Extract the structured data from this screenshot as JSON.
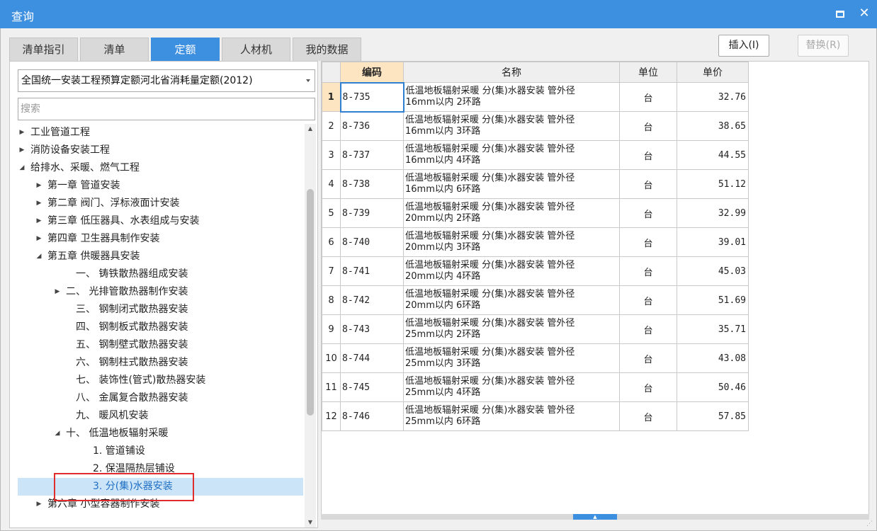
{
  "window": {
    "title": "查询"
  },
  "tabs": [
    {
      "label": "清单指引"
    },
    {
      "label": "清单"
    },
    {
      "label": "定额"
    },
    {
      "label": "人材机"
    },
    {
      "label": "我的数据"
    }
  ],
  "buttons": {
    "insert": "插入(I)",
    "replace": "替换(R)"
  },
  "left": {
    "dropdown_value": "全国统一安装工程预算定额河北省消耗量定额(2012)",
    "search_placeholder": "搜索"
  },
  "tree": [
    {
      "label": "工业管道工程",
      "arrow": "right"
    },
    {
      "label": "消防设备安装工程",
      "arrow": "right"
    },
    {
      "label": "给排水、采暖、燃气工程",
      "arrow": "down"
    },
    {
      "label": "第一章 管道安装",
      "arrow": "right"
    },
    {
      "label": "第二章 阀门、浮标液面计安装",
      "arrow": "right"
    },
    {
      "label": "第三章 低压器具、水表组成与安装",
      "arrow": "right"
    },
    {
      "label": "第四章 卫生器具制作安装",
      "arrow": "right"
    },
    {
      "label": "第五章 供暖器具安装",
      "arrow": "down"
    },
    {
      "label": "一、 铸铁散热器组成安装",
      "arrow": "none"
    },
    {
      "label": "二、 光排管散热器制作安装",
      "arrow": "right"
    },
    {
      "label": "三、 钢制闭式散热器安装",
      "arrow": "none"
    },
    {
      "label": "四、 钢制板式散热器安装",
      "arrow": "none"
    },
    {
      "label": "五、 钢制壁式散热器安装",
      "arrow": "none"
    },
    {
      "label": "六、 钢制柱式散热器安装",
      "arrow": "none"
    },
    {
      "label": "七、 装饰性(管式)散热器安装",
      "arrow": "none"
    },
    {
      "label": "八、 金属复合散热器安装",
      "arrow": "none"
    },
    {
      "label": "九、 暖风机安装",
      "arrow": "none"
    },
    {
      "label": "十、 低温地板辐射采暖",
      "arrow": "down"
    },
    {
      "label": "1. 管道铺设",
      "arrow": "none"
    },
    {
      "label": "2. 保温隔热层铺设",
      "arrow": "none"
    },
    {
      "label": "3. 分(集)水器安装",
      "arrow": "none",
      "selected": true
    },
    {
      "label": "第六章 小型容器制作安装",
      "arrow": "right"
    }
  ],
  "grid": {
    "headers": {
      "code": "编码",
      "name": "名称",
      "unit": "单位",
      "price": "单价"
    },
    "rows": [
      {
        "num": "1",
        "code": "8-735",
        "name_line1": "低温地板辐射采暖 分(集)水器安装 管外径",
        "name_line2": "16mm以内 2环路",
        "unit": "台",
        "price": "32.76"
      },
      {
        "num": "2",
        "code": "8-736",
        "name_line1": "低温地板辐射采暖 分(集)水器安装 管外径",
        "name_line2": "16mm以内 3环路",
        "unit": "台",
        "price": "38.65"
      },
      {
        "num": "3",
        "code": "8-737",
        "name_line1": "低温地板辐射采暖 分(集)水器安装 管外径",
        "name_line2": "16mm以内 4环路",
        "unit": "台",
        "price": "44.55"
      },
      {
        "num": "4",
        "code": "8-738",
        "name_line1": "低温地板辐射采暖 分(集)水器安装 管外径",
        "name_line2": "16mm以内 6环路",
        "unit": "台",
        "price": "51.12"
      },
      {
        "num": "5",
        "code": "8-739",
        "name_line1": "低温地板辐射采暖 分(集)水器安装 管外径",
        "name_line2": "20mm以内 2环路",
        "unit": "台",
        "price": "32.99"
      },
      {
        "num": "6",
        "code": "8-740",
        "name_line1": "低温地板辐射采暖 分(集)水器安装 管外径",
        "name_line2": "20mm以内 3环路",
        "unit": "台",
        "price": "39.01"
      },
      {
        "num": "7",
        "code": "8-741",
        "name_line1": "低温地板辐射采暖 分(集)水器安装 管外径",
        "name_line2": "20mm以内 4环路",
        "unit": "台",
        "price": "45.03"
      },
      {
        "num": "8",
        "code": "8-742",
        "name_line1": "低温地板辐射采暖 分(集)水器安装 管外径",
        "name_line2": "20mm以内 6环路",
        "unit": "台",
        "price": "51.69"
      },
      {
        "num": "9",
        "code": "8-743",
        "name_line1": "低温地板辐射采暖 分(集)水器安装 管外径",
        "name_line2": "25mm以内 2环路",
        "unit": "台",
        "price": "35.71"
      },
      {
        "num": "10",
        "code": "8-744",
        "name_line1": "低温地板辐射采暖 分(集)水器安装 管外径",
        "name_line2": "25mm以内 3环路",
        "unit": "台",
        "price": "43.08"
      },
      {
        "num": "11",
        "code": "8-745",
        "name_line1": "低温地板辐射采暖 分(集)水器安装 管外径",
        "name_line2": "25mm以内 4环路",
        "unit": "台",
        "price": "50.46"
      },
      {
        "num": "12",
        "code": "8-746",
        "name_line1": "低温地板辐射采暖 分(集)水器安装 管外径",
        "name_line2": "25mm以内 6环路",
        "unit": "台",
        "price": "57.85"
      }
    ]
  },
  "colors": {
    "accent": "#3d8fe0",
    "selected_row_bg": "#fde5c2",
    "highlight_border": "#e02c2c",
    "tree_selected_bg": "#cce4f7"
  },
  "icons": {
    "maximize": "maximize-icon",
    "close": "close-icon",
    "expand": "chevron-right-icon",
    "collapse": "chevron-down-icon"
  }
}
